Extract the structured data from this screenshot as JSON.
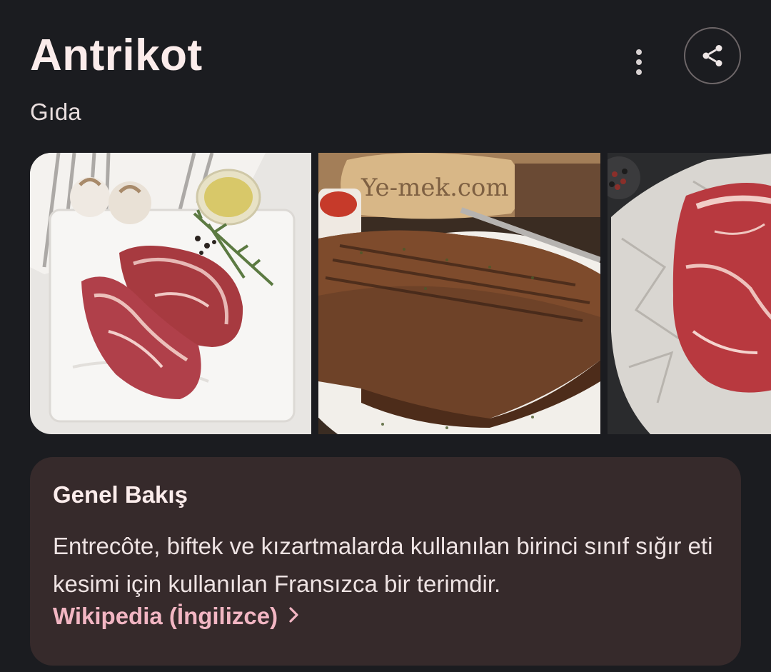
{
  "header": {
    "title": "Antrikot",
    "subtitle": "Gıda"
  },
  "actions": {
    "more_icon": "more-vertical-icon",
    "share_icon": "share-icon"
  },
  "images": [
    {
      "name": "raw-steaks-on-marble-board-image"
    },
    {
      "name": "grilled-steak-on-plate-image"
    },
    {
      "name": "raw-steak-on-paper-image"
    }
  ],
  "overview": {
    "title": "Genel Bakış",
    "text": "Entrecôte, biftek ve kızartmalarda kullanılan birinci sınıf sığır eti kesimi için kullanılan Fransızca bir terimdir.",
    "link_label": "Wikipedia (İngilizce)",
    "link_icon": "chevron-right-icon"
  },
  "colors": {
    "background": "#1b1c20",
    "card": "#362a2b",
    "link": "#f2b6c3"
  }
}
